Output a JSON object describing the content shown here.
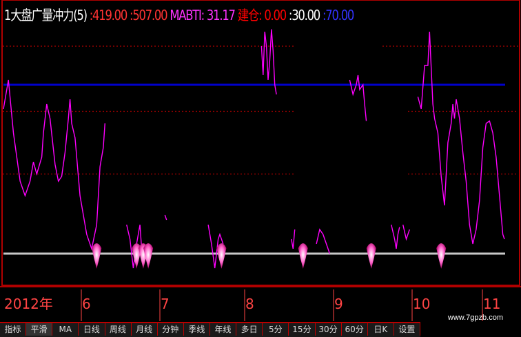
{
  "header": {
    "name": "1大盘广量冲力(5)",
    "v1": ":419.00",
    "v2": ":507.00",
    "mabti": "MABTI: 31.17",
    "jiancang": "建仓: 0.00",
    "v3": ":30.00",
    "v4": ":70.00"
  },
  "colors": {
    "background": "#000000",
    "frame": "#b00000",
    "main_line": "#ff00ff",
    "level_line": "#0000cc",
    "base_line": "#c8c8c8",
    "signal": "#ff66cc",
    "hdr_name": "#ffffff",
    "hdr_values": "#ff3333",
    "hdr_mabti": "#ff33ff",
    "hdr_jiancang": "#ff0000",
    "hdr_v3": "#ffffff",
    "hdr_v4": "#3333ff",
    "axis_text": "#ff4444"
  },
  "chart_data": {
    "type": "line",
    "x_axis": {
      "labels": [
        "2012年",
        "6",
        "7",
        "8",
        "9",
        "10",
        "11"
      ]
    },
    "ylim": [
      0,
      100
    ],
    "reference_lines": {
      "blue": 70,
      "white": 0,
      "dotted": [
        86,
        59,
        33
      ]
    },
    "series": [
      {
        "segments": [
          [
            [
              0,
              60
            ],
            [
              3,
              72
            ],
            [
              6,
              50
            ],
            [
              10,
              30
            ],
            [
              13,
              24
            ],
            [
              16,
              30
            ],
            [
              18,
              38
            ],
            [
              20,
              33
            ],
            [
              23,
              40
            ],
            [
              24,
              50
            ],
            [
              26,
              62
            ],
            [
              28,
              56
            ],
            [
              31,
              37
            ],
            [
              33,
              30
            ],
            [
              35,
              32
            ],
            [
              37,
              42
            ],
            [
              39,
              56
            ],
            [
              40,
              64
            ],
            [
              41,
              54
            ],
            [
              43,
              48
            ],
            [
              46,
              24
            ],
            [
              50,
              8
            ],
            [
              53,
              2
            ],
            [
              56,
              12
            ],
            [
              58,
              36
            ],
            [
              60,
              44
            ],
            [
              61,
              54
            ]
          ],
          [
            [
              74,
              12
            ],
            [
              76,
              6
            ],
            [
              78,
              -6
            ],
            [
              80,
              4
            ],
            [
              82,
              12
            ],
            [
              83,
              2
            ]
          ],
          [
            [
              97,
              16
            ],
            [
              98,
              14
            ]
          ],
          [
            [
              123,
              12
            ],
            [
              125,
              4
            ],
            [
              127,
              -6
            ],
            [
              129,
              6
            ],
            [
              130,
              8
            ],
            [
              132,
              4
            ]
          ],
          [
            [
              155,
              86
            ],
            [
              156,
              74
            ],
            [
              157,
              92
            ],
            [
              158,
              86
            ],
            [
              159,
              72
            ],
            [
              160,
              80
            ],
            [
              161,
              93
            ],
            [
              162,
              84
            ],
            [
              163,
              70
            ],
            [
              164,
              66
            ]
          ],
          [
            [
              173,
              6
            ],
            [
              174,
              2
            ],
            [
              175,
              10
            ]
          ],
          [
            [
              188,
              4
            ],
            [
              190,
              10
            ],
            [
              192,
              8
            ],
            [
              194,
              4
            ],
            [
              196,
              0
            ]
          ],
          [
            [
              208,
              72
            ],
            [
              210,
              66
            ],
            [
              212,
              70
            ],
            [
              213,
              74
            ],
            [
              214,
              68
            ],
            [
              216,
              70
            ],
            [
              217,
              62
            ],
            [
              218,
              55
            ]
          ],
          [
            [
              233,
              12
            ],
            [
              235,
              6
            ],
            [
              236,
              2
            ],
            [
              237,
              8
            ],
            [
              238,
              11
            ]
          ],
          [
            [
              240,
              12
            ],
            [
              242,
              6
            ],
            [
              244,
              10
            ]
          ],
          [
            [
              249,
              65
            ],
            [
              251,
              60
            ],
            [
              253,
              78
            ],
            [
              255,
              78
            ],
            [
              256,
              92
            ],
            [
              258,
              62
            ],
            [
              259,
              56
            ],
            [
              261,
              50
            ],
            [
              263,
              32
            ],
            [
              265,
              20
            ],
            [
              267,
              46
            ],
            [
              269,
              54
            ],
            [
              270,
              62
            ],
            [
              271,
              56
            ],
            [
              272,
              64
            ],
            [
              274,
              56
            ],
            [
              276,
              42
            ],
            [
              278,
              30
            ],
            [
              280,
              12
            ],
            [
              282,
              4
            ],
            [
              284,
              10
            ],
            [
              286,
              22
            ],
            [
              288,
              44
            ],
            [
              290,
              54
            ],
            [
              292,
              55
            ],
            [
              294,
              50
            ],
            [
              296,
              40
            ],
            [
              298,
              24
            ],
            [
              300,
              8
            ],
            [
              301,
              6
            ]
          ]
        ]
      }
    ],
    "signals": [
      56,
      80,
      84,
      87,
      131,
      180,
      221,
      263
    ]
  },
  "tabs": [
    "指标",
    "平滑",
    "MA",
    "日线",
    "周线",
    "月线",
    "分钟",
    "季线",
    "年线",
    "多日",
    "5分",
    "15分",
    "30分",
    "60分",
    "日K",
    "设置"
  ]
}
